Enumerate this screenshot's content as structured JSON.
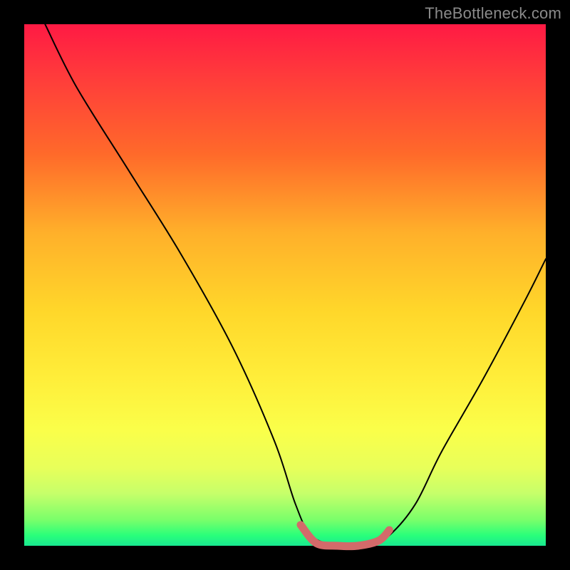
{
  "watermark": "TheBottleneck.com",
  "chart_data": {
    "type": "line",
    "title": "",
    "xlabel": "",
    "ylabel": "",
    "xlim": [
      0,
      100
    ],
    "ylim": [
      0,
      100
    ],
    "grid": false,
    "series": [
      {
        "name": "curve",
        "x": [
          4,
          10,
          20,
          30,
          40,
          48,
          52,
          55,
          60,
          66,
          70,
          75,
          80,
          88,
          96,
          100
        ],
        "y": [
          100,
          88,
          72,
          56,
          38,
          20,
          8,
          2,
          0,
          0,
          2,
          8,
          18,
          32,
          47,
          55
        ]
      },
      {
        "name": "highlight",
        "x": [
          53,
          56,
          60,
          64,
          68,
          70
        ],
        "y": [
          4,
          0.5,
          0,
          0,
          1,
          3
        ]
      }
    ],
    "colors": {
      "curve": "#000000",
      "highlight": "#d36a6a",
      "gradient_top": "#ff1a44",
      "gradient_mid": "#ffee3a",
      "gradient_bottom": "#18e890"
    }
  }
}
